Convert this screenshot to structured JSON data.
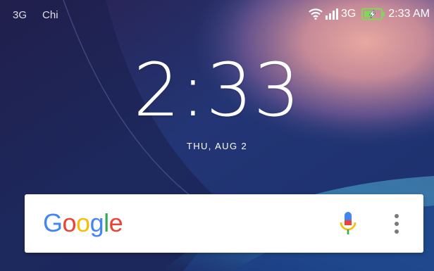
{
  "status_bar": {
    "left_network": "3G",
    "left_carrier": "Chi",
    "network_type": "3G",
    "time": "2:33 AM",
    "icons": [
      "wifi-icon",
      "signal-icon",
      "battery-charging-icon"
    ]
  },
  "lockscreen": {
    "clock": "2:33",
    "date": "THU, AUG 2"
  },
  "search_widget": {
    "logo_text": "Google",
    "logo_letters": [
      "G",
      "o",
      "o",
      "g",
      "l",
      "e"
    ],
    "icons": [
      "mic-icon",
      "more-vert-icon"
    ]
  },
  "colors": {
    "google_blue": "#4285F4",
    "google_red": "#EA4335",
    "google_yellow": "#FBBC05",
    "google_green": "#34A853",
    "battery_green": "#7ed957"
  }
}
